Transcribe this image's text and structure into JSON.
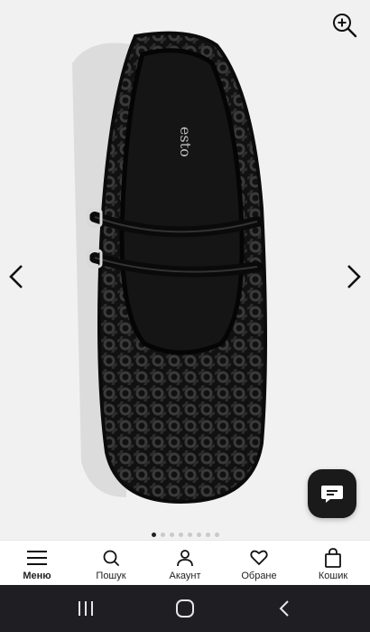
{
  "product": {
    "brand_on_insole": "esto",
    "image_count": 8,
    "active_image_index": 0
  },
  "icons": {
    "zoom": "zoom-in-icon",
    "prev": "chevron-left-icon",
    "next": "chevron-right-icon",
    "chat": "chat-bubble-icon"
  },
  "bottom_nav": {
    "items": [
      {
        "label": "Меню",
        "icon": "hamburger-menu-icon"
      },
      {
        "label": "Пошук",
        "icon": "search-icon"
      },
      {
        "label": "Акаунт",
        "icon": "user-icon"
      },
      {
        "label": "Обране",
        "icon": "heart-icon"
      },
      {
        "label": "Кошик",
        "icon": "shopping-bag-icon"
      }
    ]
  },
  "system_nav": {
    "buttons": [
      "recent-apps-icon",
      "home-icon",
      "back-icon"
    ]
  },
  "colors": {
    "accent": "#1a1a1a",
    "background": "#f1f1f1",
    "system_bar": "#1f1f23"
  }
}
